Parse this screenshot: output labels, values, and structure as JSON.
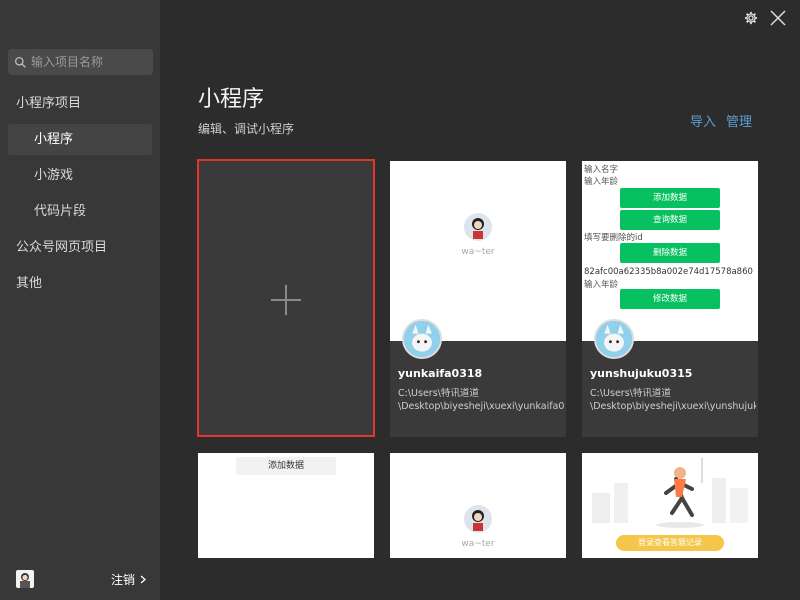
{
  "sidebar": {
    "search_placeholder": "输入项目名称",
    "items": [
      {
        "label": "小程序项目",
        "level": 1,
        "active": false
      },
      {
        "label": "小程序",
        "level": 2,
        "active": true
      },
      {
        "label": "小游戏",
        "level": 2,
        "active": false
      },
      {
        "label": "代码片段",
        "level": 2,
        "active": false
      },
      {
        "label": "公众号网页项目",
        "level": 1,
        "active": false
      },
      {
        "label": "其他",
        "level": 1,
        "active": false
      }
    ],
    "footer": {
      "logout_label": "注销"
    }
  },
  "header": {
    "title": "小程序",
    "subtitle": "编辑、调试小程序",
    "import_label": "导入",
    "manage_label": "管理"
  },
  "projects": [
    {
      "name": "yunkaifa0318",
      "path_line1": "C:\\Users\\特讯道道",
      "path_line2": "\\Desktop\\biyesheji\\xuexi\\yunkaifa03",
      "preview_label": "wa~ter"
    },
    {
      "name": "yunshujuku0315",
      "path_line1": "C:\\Users\\特讯道道",
      "path_line2": "\\Desktop\\biyesheji\\xuexi\\yunshujuk",
      "preview": {
        "text1": "输入名字",
        "text2": "输入年龄",
        "btn_add": "添加数据",
        "btn_query": "查询数据",
        "text3": "填写要删除的id",
        "btn_delete": "删除数据",
        "id_value": "82afc00a62335b8a002e74d17578a860",
        "text4": "输入年龄",
        "btn_modify": "修改数据"
      }
    }
  ],
  "bottom_cards": {
    "card1_chip": "添加数据",
    "card2_label": "wa~ter",
    "card3_button": "登录查看答题记录"
  },
  "colors": {
    "accent_link": "#5a9fd6",
    "selection_border": "#e4342c",
    "green_button": "#07c160"
  }
}
